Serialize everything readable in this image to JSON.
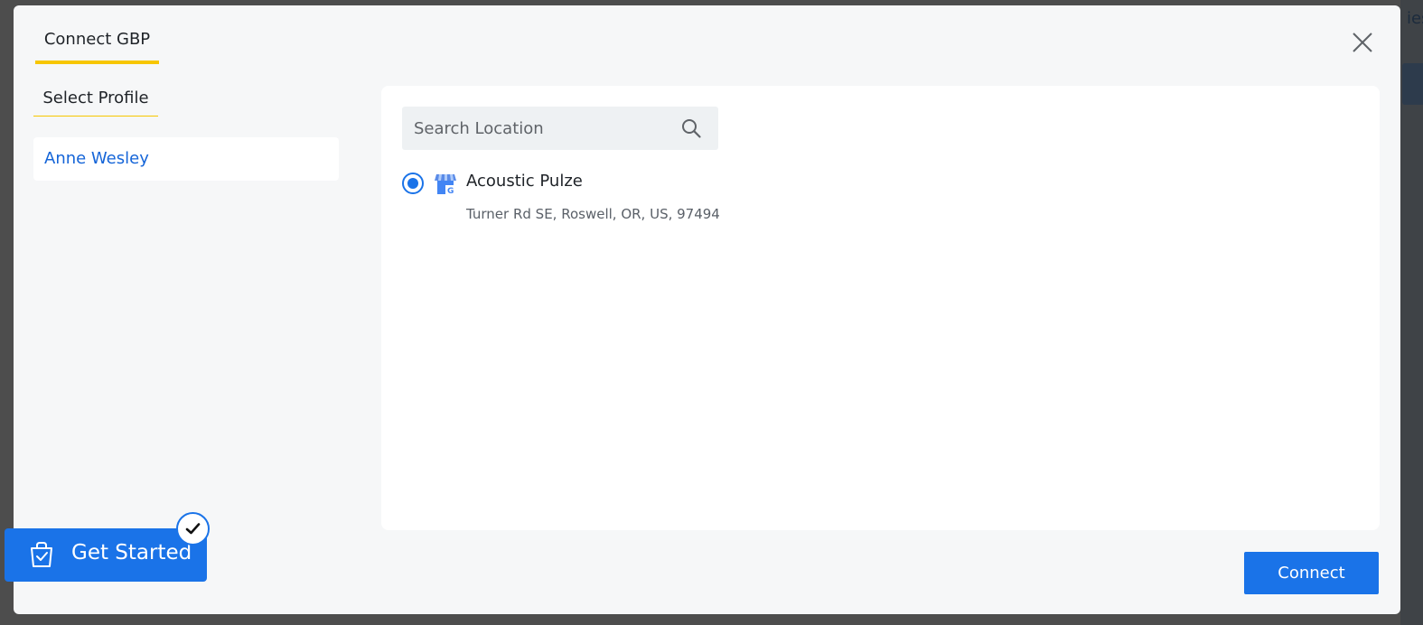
{
  "modal": {
    "tab_title": "Connect GBP",
    "section_label": "Select Profile"
  },
  "profiles": [
    {
      "name": "Anne Wesley",
      "selected": true
    }
  ],
  "search": {
    "placeholder": "Search Location",
    "value": ""
  },
  "locations": [
    {
      "name": "Acoustic Pulze",
      "address": "Turner Rd SE, Roswell, OR, US, 97494",
      "selected": true,
      "icon": "google-business-icon"
    }
  ],
  "actions": {
    "connect_label": "Connect"
  },
  "get_started": {
    "label": "Get Started",
    "icon": "checklist-bag-icon",
    "badge_icon": "checkmark-icon"
  },
  "colors": {
    "accent": "#1a73e8",
    "tab_underline": "#f7c600",
    "profile_link": "#1565d8"
  }
}
